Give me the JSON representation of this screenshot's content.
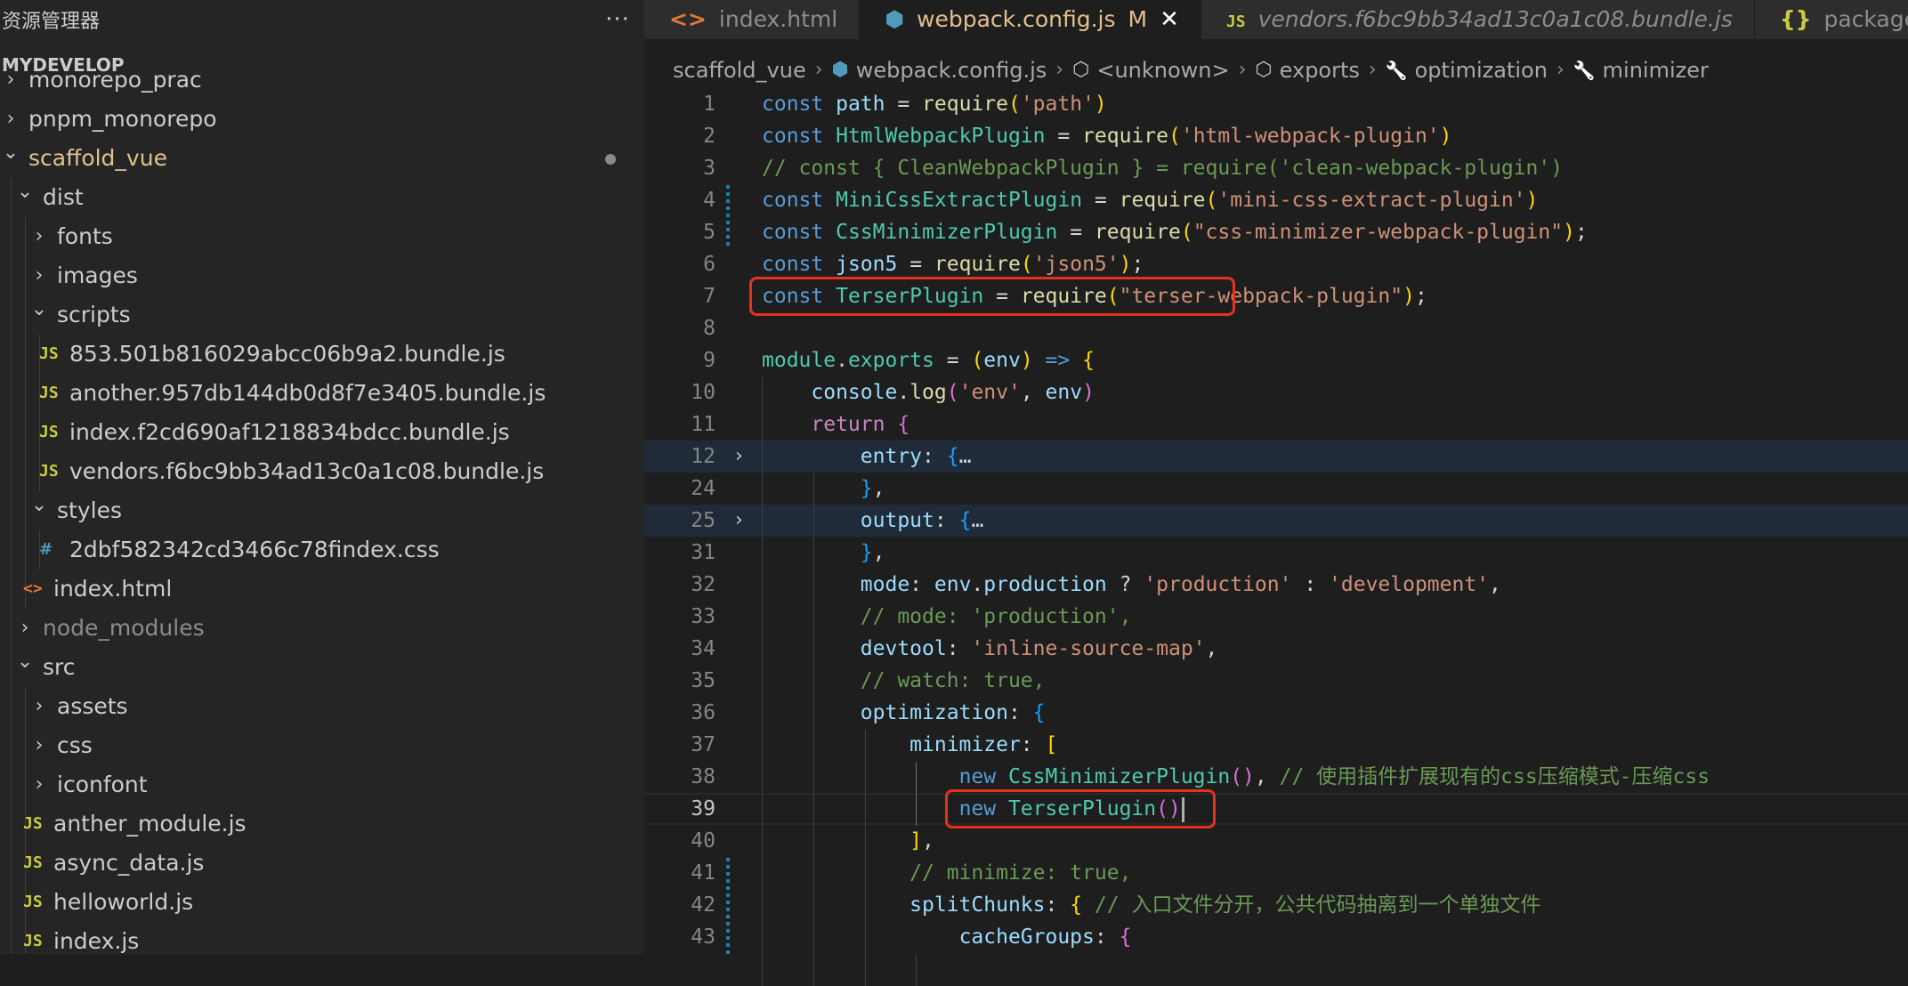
{
  "sidebar": {
    "title": "资源管理器",
    "more": "···",
    "section": "MYDEVELOP",
    "tree": [
      {
        "label": "monorepo_prac",
        "depth": 0,
        "chev": "›",
        "type": "folder"
      },
      {
        "label": "pnpm_monorepo",
        "depth": 0,
        "chev": "›",
        "type": "folder"
      },
      {
        "label": "scaffold_vue",
        "depth": 0,
        "chev": "⌄",
        "type": "folder",
        "modified": true
      },
      {
        "label": "dist",
        "depth": 1,
        "chev": "⌄",
        "type": "folder"
      },
      {
        "label": "fonts",
        "depth": 2,
        "chev": "›",
        "type": "folder"
      },
      {
        "label": "images",
        "depth": 2,
        "chev": "›",
        "type": "folder"
      },
      {
        "label": "scripts",
        "depth": 2,
        "chev": "⌄",
        "type": "folder"
      },
      {
        "label": "853.501b816029abcc06b9a2.bundle.js",
        "depth": 3,
        "type": "js"
      },
      {
        "label": "another.957db144db0d8f7e3405.bundle.js",
        "depth": 3,
        "type": "js"
      },
      {
        "label": "index.f2cd690af1218834bdcc.bundle.js",
        "depth": 3,
        "type": "js"
      },
      {
        "label": "vendors.f6bc9bb34ad13c0a1c08.bundle.js",
        "depth": 3,
        "type": "js"
      },
      {
        "label": "styles",
        "depth": 2,
        "chev": "⌄",
        "type": "folder"
      },
      {
        "label": "2dbf582342cd3466c78findex.css",
        "depth": 3,
        "type": "css"
      },
      {
        "label": "index.html",
        "depth": 2,
        "type": "html"
      },
      {
        "label": "node_modules",
        "depth": 1,
        "chev": "›",
        "type": "folder",
        "dim": true
      },
      {
        "label": "src",
        "depth": 1,
        "chev": "⌄",
        "type": "folder"
      },
      {
        "label": "assets",
        "depth": 2,
        "chev": "›",
        "type": "folder"
      },
      {
        "label": "css",
        "depth": 2,
        "chev": "›",
        "type": "folder"
      },
      {
        "label": "iconfont",
        "depth": 2,
        "chev": "›",
        "type": "folder"
      },
      {
        "label": "anther_module.js",
        "depth": 2,
        "type": "js"
      },
      {
        "label": "async_data.js",
        "depth": 2,
        "type": "js"
      },
      {
        "label": "helloworld.js",
        "depth": 2,
        "type": "js"
      },
      {
        "label": "index.js",
        "depth": 2,
        "type": "js"
      }
    ]
  },
  "tabs": [
    {
      "label": "index.html",
      "icon": "<>",
      "icon_type": "html"
    },
    {
      "label": "webpack.config.js",
      "icon": "⬢",
      "icon_type": "webpack",
      "active": true,
      "modified": "M",
      "close": "✕"
    },
    {
      "label": "vendors.f6bc9bb34ad13c0a1c08.bundle.js",
      "icon": "JS",
      "icon_type": "js",
      "italic": true
    },
    {
      "label": "package",
      "icon": "{}",
      "icon_type": "json"
    }
  ],
  "breadcrumb": [
    {
      "label": "scaffold_vue",
      "icon": ""
    },
    {
      "label": "webpack.config.js",
      "icon": "⬢",
      "icon_type": "webpack"
    },
    {
      "label": "<unknown>",
      "icon": "⬡",
      "icon_type": "cube"
    },
    {
      "label": "exports",
      "icon": "⬡",
      "icon_type": "cube"
    },
    {
      "label": "optimization",
      "icon": "🔧",
      "icon_type": "wrench"
    },
    {
      "label": "minimizer",
      "icon": "🔧",
      "icon_type": "wrench"
    }
  ],
  "editor": {
    "lines": [
      {
        "n": "1",
        "tokens": [
          [
            "kw",
            "const "
          ],
          [
            "vr",
            "path"
          ],
          [
            "pn",
            " = "
          ],
          [
            "fn",
            "require"
          ],
          [
            "br1",
            "("
          ],
          [
            "str",
            "'path'"
          ],
          [
            "br1",
            ")"
          ]
        ]
      },
      {
        "n": "2",
        "tokens": [
          [
            "kw",
            "const "
          ],
          [
            "cls",
            "HtmlWebpackPlugin"
          ],
          [
            "pn",
            " = "
          ],
          [
            "fn",
            "require"
          ],
          [
            "br1",
            "("
          ],
          [
            "str",
            "'html-webpack-plugin'"
          ],
          [
            "br1",
            ")"
          ]
        ]
      },
      {
        "n": "3",
        "tokens": [
          [
            "cm",
            "// const { CleanWebpackPlugin } = require('clean-webpack-plugin')"
          ]
        ]
      },
      {
        "n": "4",
        "tokens": [
          [
            "kw",
            "const "
          ],
          [
            "cls",
            "MiniCssExtractPlugin"
          ],
          [
            "pn",
            " = "
          ],
          [
            "fn",
            "require"
          ],
          [
            "br1",
            "("
          ],
          [
            "str",
            "'mini-css-extract-plugin'"
          ],
          [
            "br1",
            ")"
          ]
        ]
      },
      {
        "n": "5",
        "tokens": [
          [
            "kw",
            "const "
          ],
          [
            "cls",
            "CssMinimizerPlugin"
          ],
          [
            "pn",
            " = "
          ],
          [
            "fn",
            "require"
          ],
          [
            "br1",
            "("
          ],
          [
            "str",
            "\"css-minimizer-webpack-plugin\""
          ],
          [
            "br1",
            ")"
          ],
          [
            "pn",
            ";"
          ]
        ]
      },
      {
        "n": "6",
        "tokens": [
          [
            "kw",
            "const "
          ],
          [
            "vr",
            "json5"
          ],
          [
            "pn",
            " = "
          ],
          [
            "fn",
            "require"
          ],
          [
            "br1",
            "("
          ],
          [
            "str",
            "'json5'"
          ],
          [
            "br1",
            ")"
          ],
          [
            "pn",
            ";"
          ]
        ]
      },
      {
        "n": "7",
        "tokens": [
          [
            "kw",
            "const "
          ],
          [
            "cls",
            "TerserPlugin"
          ],
          [
            "pn",
            " = "
          ],
          [
            "fn",
            "require"
          ],
          [
            "br1",
            "("
          ],
          [
            "str",
            "\"terser-webpack-plugin\""
          ],
          [
            "br1",
            ")"
          ],
          [
            "pn",
            ";"
          ]
        ]
      },
      {
        "n": "8",
        "tokens": []
      },
      {
        "n": "9",
        "tokens": [
          [
            "cls",
            "module"
          ],
          [
            "pn",
            "."
          ],
          [
            "cls",
            "exports"
          ],
          [
            "pn",
            " = "
          ],
          [
            "br1",
            "("
          ],
          [
            "vr",
            "env"
          ],
          [
            "br1",
            ")"
          ],
          [
            "kw",
            " => "
          ],
          [
            "br1",
            "{"
          ]
        ]
      },
      {
        "n": "10",
        "tokens": [
          [
            "pn",
            "    "
          ],
          [
            "vr",
            "console"
          ],
          [
            "pn",
            "."
          ],
          [
            "fn",
            "log"
          ],
          [
            "br2",
            "("
          ],
          [
            "str",
            "'env'"
          ],
          [
            "pn",
            ", "
          ],
          [
            "vr",
            "env"
          ],
          [
            "br2",
            ")"
          ]
        ]
      },
      {
        "n": "11",
        "tokens": [
          [
            "pn",
            "    "
          ],
          [
            "kw2",
            "return "
          ],
          [
            "br2",
            "{"
          ]
        ]
      },
      {
        "n": "12",
        "tokens": [
          [
            "pn",
            "        "
          ],
          [
            "vr",
            "entry"
          ],
          [
            "pn",
            ": "
          ],
          [
            "br3",
            "{"
          ],
          [
            "pn",
            "…"
          ]
        ],
        "fold": true
      },
      {
        "n": "24",
        "tokens": [
          [
            "pn",
            "        "
          ],
          [
            "br3",
            "}"
          ],
          [
            "pn",
            ","
          ]
        ]
      },
      {
        "n": "25",
        "tokens": [
          [
            "pn",
            "        "
          ],
          [
            "vr",
            "output"
          ],
          [
            "pn",
            ": "
          ],
          [
            "br3",
            "{"
          ],
          [
            "pn",
            "…"
          ]
        ],
        "fold": true
      },
      {
        "n": "31",
        "tokens": [
          [
            "pn",
            "        "
          ],
          [
            "br3",
            "}"
          ],
          [
            "pn",
            ","
          ]
        ]
      },
      {
        "n": "32",
        "tokens": [
          [
            "pn",
            "        "
          ],
          [
            "vr",
            "mode"
          ],
          [
            "pn",
            ": "
          ],
          [
            "vr",
            "env"
          ],
          [
            "pn",
            "."
          ],
          [
            "vr",
            "production"
          ],
          [
            "pn",
            " ? "
          ],
          [
            "str",
            "'production'"
          ],
          [
            "pn",
            " : "
          ],
          [
            "str",
            "'development'"
          ],
          [
            "pn",
            ","
          ]
        ]
      },
      {
        "n": "33",
        "tokens": [
          [
            "pn",
            "        "
          ],
          [
            "cm",
            "// mode: 'production',"
          ]
        ]
      },
      {
        "n": "34",
        "tokens": [
          [
            "pn",
            "        "
          ],
          [
            "vr",
            "devtool"
          ],
          [
            "pn",
            ": "
          ],
          [
            "str",
            "'inline-source-map'"
          ],
          [
            "pn",
            ","
          ]
        ]
      },
      {
        "n": "35",
        "tokens": [
          [
            "pn",
            "        "
          ],
          [
            "cm",
            "// watch: true,"
          ]
        ]
      },
      {
        "n": "36",
        "tokens": [
          [
            "pn",
            "        "
          ],
          [
            "vr",
            "optimization"
          ],
          [
            "pn",
            ": "
          ],
          [
            "br3",
            "{"
          ]
        ]
      },
      {
        "n": "37",
        "tokens": [
          [
            "pn",
            "            "
          ],
          [
            "vr",
            "minimizer"
          ],
          [
            "pn",
            ": "
          ],
          [
            "br1",
            "["
          ]
        ]
      },
      {
        "n": "38",
        "tokens": [
          [
            "pn",
            "                "
          ],
          [
            "kw",
            "new "
          ],
          [
            "cls",
            "CssMinimizerPlugin"
          ],
          [
            "br2",
            "()"
          ],
          [
            "pn",
            ", "
          ],
          [
            "cm",
            "// 使用插件扩展现有的css压缩模式-压缩css"
          ]
        ]
      },
      {
        "n": "39",
        "tokens": [
          [
            "pn",
            "                "
          ],
          [
            "kw",
            "new "
          ],
          [
            "cls",
            "TerserPlugin"
          ],
          [
            "br2",
            "()"
          ]
        ],
        "current": true
      },
      {
        "n": "40",
        "tokens": [
          [
            "pn",
            "            "
          ],
          [
            "br1",
            "]"
          ],
          [
            "pn",
            ","
          ]
        ]
      },
      {
        "n": "41",
        "tokens": [
          [
            "pn",
            "            "
          ],
          [
            "cm",
            "// minimize: true,"
          ]
        ]
      },
      {
        "n": "42",
        "tokens": [
          [
            "pn",
            "            "
          ],
          [
            "vr",
            "splitChunks"
          ],
          [
            "pn",
            ": "
          ],
          [
            "br1",
            "{"
          ],
          [
            "pn",
            " "
          ],
          [
            "cm",
            "// 入口文件分开，公共代码抽离到一个单独文件"
          ]
        ]
      },
      {
        "n": "43",
        "tokens": [
          [
            "pn",
            "                "
          ],
          [
            "vr",
            "cacheGroups"
          ],
          [
            "pn",
            ": "
          ],
          [
            "br2",
            "{"
          ]
        ]
      }
    ]
  },
  "colors": {
    "sidebar_bg": "#252526",
    "editor_bg": "#1e1e1e",
    "highlight_box": "#e5321c",
    "modified": "#e2c08d"
  }
}
